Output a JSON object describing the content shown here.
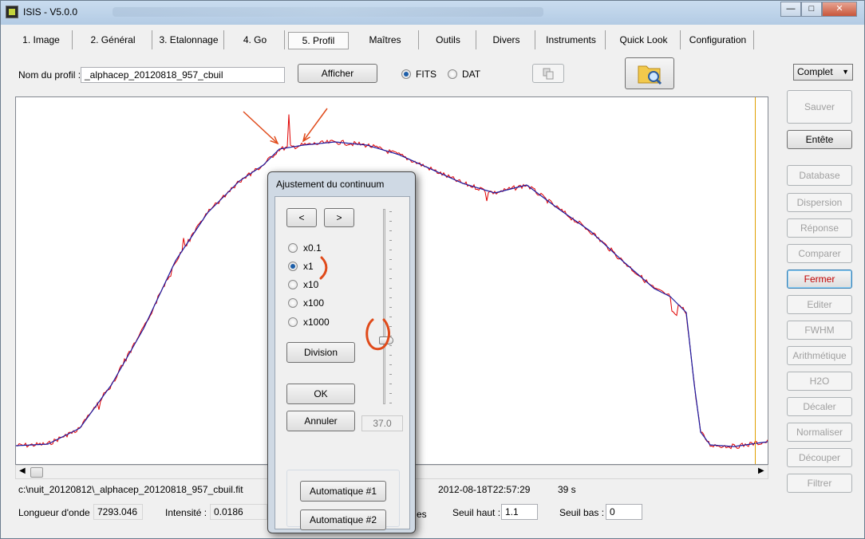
{
  "window": {
    "title": "ISIS - V5.0.0"
  },
  "tabs": [
    {
      "label": "1. Image"
    },
    {
      "label": "2. Général"
    },
    {
      "label": "3. Etalonnage"
    },
    {
      "label": "4. Go"
    },
    {
      "label": "5. Profil"
    },
    {
      "label": "Maîtres"
    },
    {
      "label": "Outils"
    },
    {
      "label": "Divers"
    },
    {
      "label": "Instruments"
    },
    {
      "label": "Quick Look"
    },
    {
      "label": "Configuration"
    }
  ],
  "profile": {
    "name_label": "Nom du profil :",
    "name_value": "_alphacep_20120818_957_cbuil",
    "show_button": "Afficher",
    "format_fits": "FITS",
    "format_dat": "DAT",
    "mode_select": "Complet"
  },
  "sidebar": {
    "buttons": [
      {
        "label": "Sauver",
        "state": "disabled"
      },
      {
        "label": "Entête",
        "state": "enabled"
      },
      {
        "label": "Database",
        "state": "disabled"
      },
      {
        "label": "Dispersion",
        "state": "disabled"
      },
      {
        "label": "Réponse",
        "state": "disabled"
      },
      {
        "label": "Comparer",
        "state": "disabled"
      },
      {
        "label": "Fermer",
        "state": "focused"
      },
      {
        "label": "Editer",
        "state": "disabled"
      },
      {
        "label": "FWHM",
        "state": "disabled"
      },
      {
        "label": "Arithmétique",
        "state": "disabled"
      },
      {
        "label": "H2O",
        "state": "disabled"
      },
      {
        "label": "Décaler",
        "state": "disabled"
      },
      {
        "label": "Normaliser",
        "state": "disabled"
      },
      {
        "label": "Découper",
        "state": "disabled"
      },
      {
        "label": "Filtrer",
        "state": "disabled"
      }
    ]
  },
  "status": {
    "path": "c:\\nuit_20120812\\_alphacep_20120818_957_cbuil.fit",
    "datetime": "2012-08-18T22:57:29",
    "exposure": "39 s",
    "wavelength_label": "Longueur d'onde :",
    "wavelength_value": "7293.046",
    "intensity_label": "Intensité :",
    "intensity_value": "0.0186",
    "partial_text": "es",
    "high_threshold_label": "Seuil haut :",
    "high_threshold_value": "1.1",
    "low_threshold_label": "Seuil bas :",
    "low_threshold_value": "0"
  },
  "dialog": {
    "title": "Ajustement du continuum",
    "prev": "<",
    "next": ">",
    "scales": [
      "x0.1",
      "x1",
      "x10",
      "x100",
      "x1000"
    ],
    "selected_scale": "x1",
    "division": "Division",
    "ok": "OK",
    "cancel": "Annuler",
    "slider_value": "37.0",
    "auto1": "Automatique #1",
    "auto2": "Automatique #2"
  },
  "colors": {
    "profile_raw": "#e00000",
    "profile_continuum": "#1a1aa0",
    "annotation": "#e04a1a",
    "cursor": "#e0a000"
  }
}
